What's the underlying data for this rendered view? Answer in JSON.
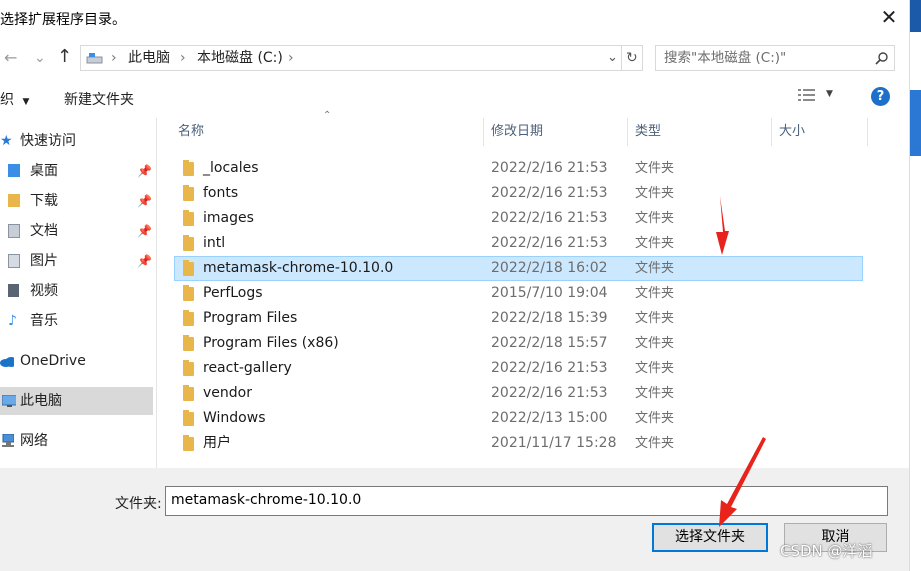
{
  "window": {
    "title": "选择扩展程序目录。"
  },
  "nav": {
    "back_icon": "←",
    "forward_icon": "→",
    "dropdown_icon": "⌄",
    "up_icon": "↑"
  },
  "address": {
    "segments": [
      "此电脑",
      "本地磁盘 (C:)"
    ],
    "separator": "›"
  },
  "search": {
    "placeholder": "搜索\"本地磁盘 (C:)\""
  },
  "toolbar": {
    "organize": "织",
    "new_folder": "新建文件夹",
    "help": "?"
  },
  "sidebar": {
    "items": [
      {
        "label": "快速访问",
        "icon": "star-icon"
      },
      {
        "label": "桌面",
        "icon": "desktop-folder-icon",
        "pinned": true
      },
      {
        "label": "下载",
        "icon": "download-folder-icon",
        "pinned": true
      },
      {
        "label": "文档",
        "icon": "documents-folder-icon",
        "pinned": true
      },
      {
        "label": "图片",
        "icon": "pictures-folder-icon",
        "pinned": true
      },
      {
        "label": "视频",
        "icon": "videos-folder-icon"
      },
      {
        "label": "音乐",
        "icon": "music-folder-icon"
      },
      {
        "label": "OneDrive",
        "icon": "cloud-icon"
      },
      {
        "label": "此电脑",
        "icon": "computer-icon"
      },
      {
        "label": "网络",
        "icon": "network-icon"
      }
    ]
  },
  "columns": {
    "name": "名称",
    "date": "修改日期",
    "type": "类型",
    "size": "大小"
  },
  "files": [
    {
      "name": "_locales",
      "date": "2022/2/16 21:53",
      "type": "文件夹"
    },
    {
      "name": "fonts",
      "date": "2022/2/16 21:53",
      "type": "文件夹"
    },
    {
      "name": "images",
      "date": "2022/2/16 21:53",
      "type": "文件夹"
    },
    {
      "name": "intl",
      "date": "2022/2/16 21:53",
      "type": "文件夹"
    },
    {
      "name": "metamask-chrome-10.10.0",
      "date": "2022/2/18 16:02",
      "type": "文件夹"
    },
    {
      "name": "PerfLogs",
      "date": "2015/7/10 19:04",
      "type": "文件夹"
    },
    {
      "name": "Program Files",
      "date": "2022/2/18 15:39",
      "type": "文件夹"
    },
    {
      "name": "Program Files (x86)",
      "date": "2022/2/18 15:57",
      "type": "文件夹"
    },
    {
      "name": "react-gallery",
      "date": "2022/2/16 21:53",
      "type": "文件夹"
    },
    {
      "name": "vendor",
      "date": "2022/2/16 21:53",
      "type": "文件夹"
    },
    {
      "name": "Windows",
      "date": "2022/2/13 15:00",
      "type": "文件夹"
    },
    {
      "name": "用户",
      "date": "2021/11/17 15:28",
      "type": "文件夹"
    }
  ],
  "footer": {
    "folder_label": "文件夹:",
    "folder_value": "metamask-chrome-10.10.0",
    "select_button": "选择文件夹",
    "cancel_button": "取消"
  },
  "watermark": "CSDN @洋滔",
  "colors": {
    "accent": "#0078d7",
    "selection": "#cce8ff",
    "annotation_arrow": "#e8231b"
  }
}
